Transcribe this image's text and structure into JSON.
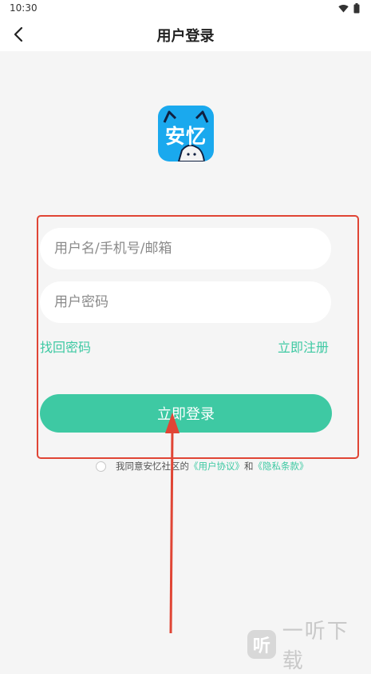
{
  "status_bar": {
    "time": "10:30"
  },
  "nav": {
    "title": "用户登录"
  },
  "logo": {
    "text": "安忆"
  },
  "form": {
    "username_placeholder": "用户名/手机号/邮箱",
    "password_placeholder": "用户密码",
    "forgot_password": "找回密码",
    "register": "立即注册",
    "login_button": "立即登录"
  },
  "agreement": {
    "prefix": "我同意安忆社区的",
    "user_agreement": "《用户协议》",
    "conjunction": "和",
    "privacy_policy": "《隐私条款》",
    "checked": false
  },
  "watermark": {
    "mark": "听",
    "text": "一听下载"
  },
  "colors": {
    "accent": "#3ec9a3",
    "annotation": "#e04535",
    "logo_bg": "#1aa9ee"
  },
  "icons": [
    "back-arrow-icon",
    "wifi-icon",
    "battery-icon"
  ]
}
